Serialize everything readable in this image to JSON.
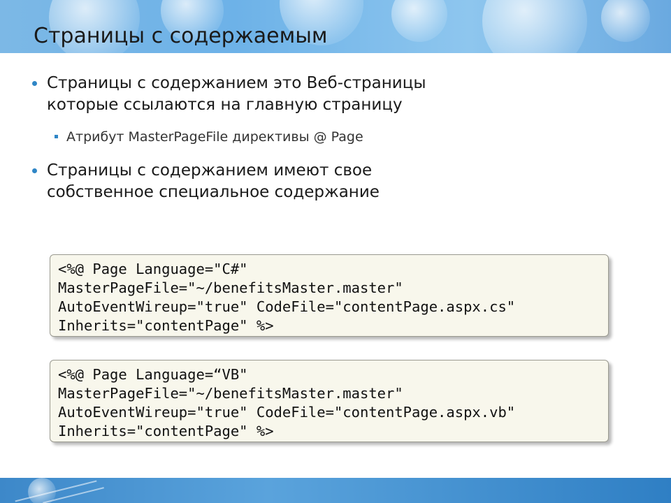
{
  "slide": {
    "title": "Страницы с содержаемым",
    "bullets": [
      {
        "lines": [
          "Страницы с содержанием это Веб-страницы",
          "которые ссылаются на главную страницу"
        ],
        "sub": [
          "Атрибут MasterPageFile директивы @ Page"
        ]
      },
      {
        "lines": [
          "Страницы с содержанием имеют свое",
          "собственное специальное содержание"
        ],
        "sub": []
      }
    ],
    "code_blocks": [
      {
        "lines": [
          "<%@ Page Language=\"C#\"",
          "MasterPageFile=\"~/benefitsMaster.master\"",
          "AutoEventWireup=\"true\" CodeFile=\"contentPage.aspx.cs\"",
          "Inherits=\"contentPage\" %>"
        ]
      },
      {
        "lines": [
          "<%@ Page Language=“VB\"",
          "MasterPageFile=\"~/benefitsMaster.master\"",
          "AutoEventWireup=\"true\" CodeFile=\"contentPage.aspx.vb\"",
          "Inherits=\"contentPage\" %>"
        ]
      }
    ]
  },
  "theme": {
    "bullet_color": "#2f86c6",
    "header_color": "#7cb8e6",
    "code_background": "#f8f7ec"
  }
}
